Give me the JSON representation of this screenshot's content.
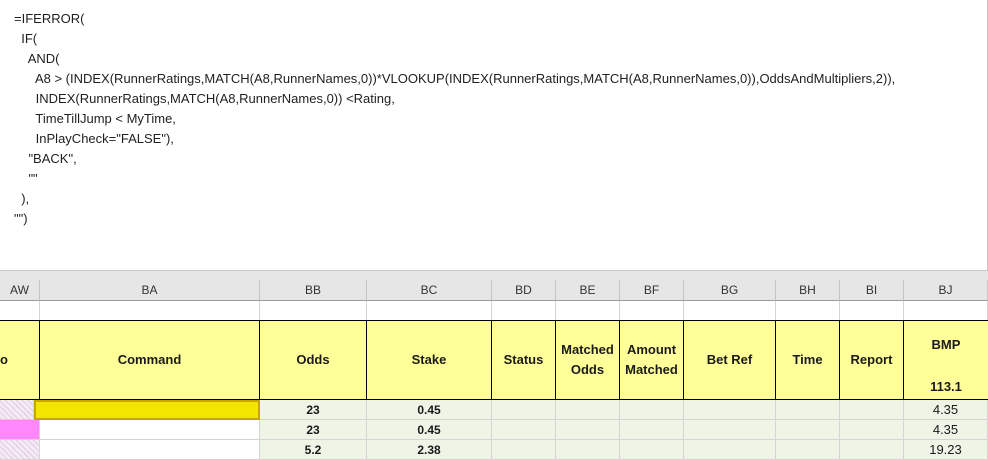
{
  "formula": {
    "lines": [
      "=IFERROR(",
      "  IF(",
      "    AND(",
      "      A8 > (INDEX(RunnerRatings,MATCH(A8,RunnerNames,0))*VLOOKUP(INDEX(RunnerRatings,MATCH(A8,RunnerNames,0)),OddsAndMultipliers,2)),",
      "      INDEX(RunnerRatings,MATCH(A8,RunnerNames,0)) <Rating,",
      "      TimeTillJump < MyTime,",
      "      InPlayCheck=\"FALSE\"),",
      "    \"BACK\",",
      "    \"\"",
      "  ),",
      "\"\")"
    ]
  },
  "columns": [
    "AW",
    "BA",
    "BB",
    "BC",
    "BD",
    "BE",
    "BF",
    "BG",
    "BH",
    "BI",
    "BJ"
  ],
  "table_headers": {
    "partial_left": "o",
    "command": "Command",
    "odds": "Odds",
    "stake": "Stake",
    "status": "Status",
    "matched_odds_1": "Matched",
    "matched_odds_2": "Odds",
    "amount_matched_1": "Amount",
    "amount_matched_2": "Matched",
    "bet_ref": "Bet Ref",
    "time": "Time",
    "report": "Report",
    "bmp": "BMP",
    "bmp_total": "113.1"
  },
  "rows": [
    {
      "odds": "23",
      "stake": "0.45",
      "bmp": "4.35"
    },
    {
      "odds": "23",
      "stake": "0.45",
      "bmp": "4.35"
    },
    {
      "odds": "5.2",
      "stake": "2.38",
      "bmp": "19.23"
    }
  ],
  "colors": {
    "header_fill": "#ffff99",
    "selected_cell": "#f2e600",
    "pink_cell": "#ff88ff",
    "row_fill": "#eef5e6"
  }
}
